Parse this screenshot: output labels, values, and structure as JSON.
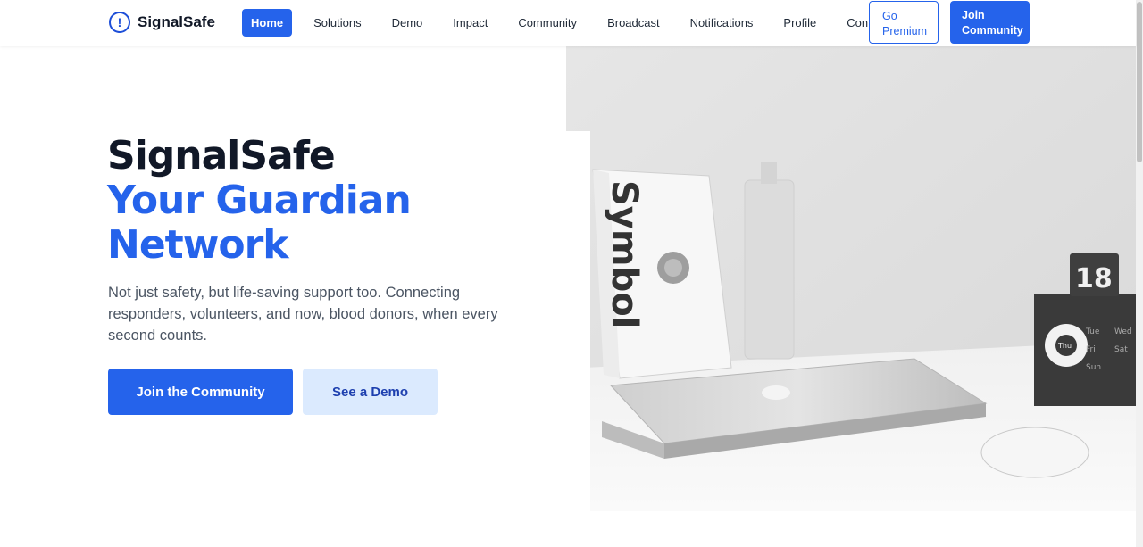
{
  "brand": {
    "icon": "alert-circle-icon",
    "glyph": "!",
    "name": "SignalSafe"
  },
  "nav": {
    "items": [
      {
        "label": "Home",
        "active": true
      },
      {
        "label": "Solutions"
      },
      {
        "label": "Demo"
      },
      {
        "label": "Impact"
      },
      {
        "label": "Community"
      },
      {
        "label": "Broadcast"
      },
      {
        "label": "Notifications"
      },
      {
        "label": "Profile"
      },
      {
        "label": "Contact"
      }
    ],
    "premium_label": "Go Premium",
    "join_label": "Join Community"
  },
  "hero": {
    "title_line1": "SignalSafe",
    "title_line2": "Your Guardian",
    "title_line3": "Network",
    "subtitle": "Not just safety, but life-saving support too. Connecting responders, volunteers, and now, blood donors, when every second counts.",
    "primary_cta": "Join the Community",
    "secondary_cta": "See a Demo"
  },
  "photo": {
    "book_text": "Symbol",
    "calendar_day": "18",
    "calendar_days": [
      "Tue",
      "Wed",
      "Thu",
      "Fri",
      "Sat",
      "Sun"
    ]
  },
  "colors": {
    "accent": "#2563eb",
    "accent_light": "#dbeafe",
    "heading": "#111827",
    "body_text": "#4b5563"
  }
}
